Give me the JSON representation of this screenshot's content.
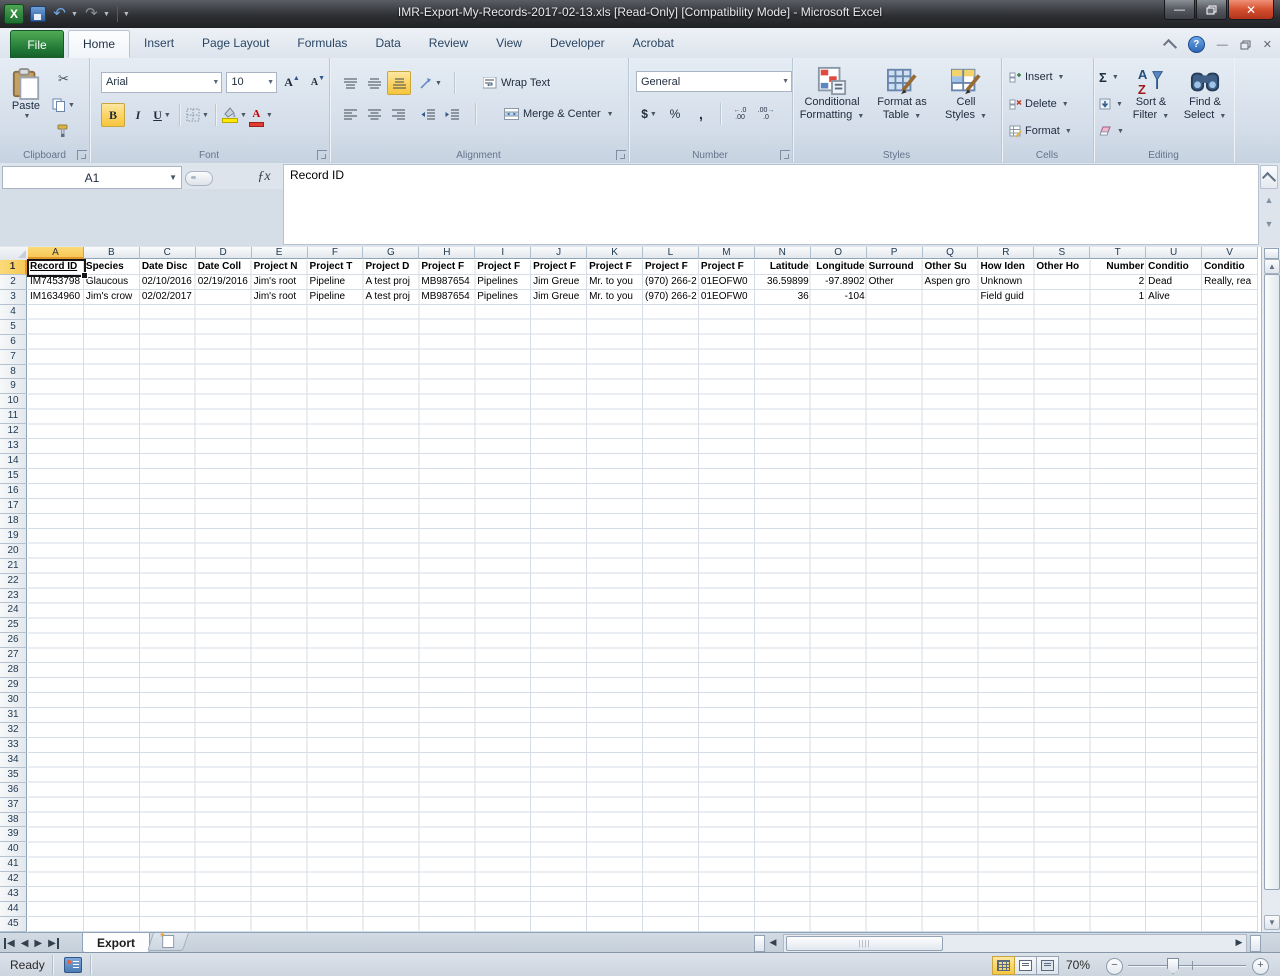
{
  "titlebar": {
    "title": "IMR-Export-My-Records-2017-02-13.xls  [Read-Only]  [Compatibility Mode]  -  Microsoft Excel"
  },
  "tabs": {
    "file": "File",
    "items": [
      "Home",
      "Insert",
      "Page Layout",
      "Formulas",
      "Data",
      "Review",
      "View",
      "Developer",
      "Acrobat"
    ],
    "active": "Home"
  },
  "ribbon": {
    "clipboard": {
      "label": "Clipboard",
      "paste": "Paste"
    },
    "font": {
      "label": "Font",
      "family": "Arial",
      "size": "10"
    },
    "alignment": {
      "label": "Alignment",
      "wrap_text": "Wrap Text",
      "merge_center": "Merge & Center"
    },
    "number": {
      "label": "Number",
      "format": "General"
    },
    "styles": {
      "label": "Styles",
      "conditional_line1": "Conditional",
      "conditional_line2": "Formatting",
      "format_table_line1": "Format as",
      "format_table_line2": "Table",
      "cell_styles_line1": "Cell",
      "cell_styles_line2": "Styles"
    },
    "cells": {
      "label": "Cells",
      "insert": "Insert",
      "delete": "Delete",
      "format": "Format"
    },
    "editing": {
      "label": "Editing",
      "sort_line1": "Sort &",
      "sort_line2": "Filter",
      "find_line1": "Find &",
      "find_line2": "Select"
    }
  },
  "formula_bar": {
    "name_box": "A1",
    "fx": "ƒx",
    "value": "Record ID"
  },
  "grid": {
    "columns": [
      "A",
      "B",
      "C",
      "D",
      "E",
      "F",
      "G",
      "H",
      "I",
      "J",
      "K",
      "L",
      "M",
      "N",
      "O",
      "P",
      "Q",
      "R",
      "S",
      "T",
      "U",
      "V"
    ],
    "visible_rows": 45,
    "selected_cell": "A1",
    "right_align_columns": [
      "N",
      "O",
      "T"
    ],
    "rows": [
      {
        "r": 1,
        "bold": true,
        "underline": [
          "A"
        ],
        "cells": {
          "A": "Record ID",
          "B": "Species",
          "C": "Date Disc",
          "D": "Date Coll",
          "E": "Project N",
          "F": "Project T",
          "G": "Project D",
          "H": "Project F",
          "I": "Project F",
          "J": "Project F",
          "K": "Project F",
          "L": "Project F",
          "M": "Project F",
          "N": "Latitude",
          "O": "Longitude",
          "P": "Surround",
          "Q": "Other Su",
          "R": "How Iden",
          "S": "Other Ho",
          "T": "Number",
          "U": "Conditio",
          "V": "Conditio"
        }
      },
      {
        "r": 2,
        "cells": {
          "A": "IM7453798",
          "B": "Glaucous",
          "C": "02/10/2016",
          "D": "02/19/2016",
          "E": "Jim's root",
          "F": "Pipeline",
          "G": "A test proj",
          "H": "MB987654",
          "I": "Pipelines",
          "J": "Jim Greue",
          "K": "Mr. to you",
          "L": "(970) 266-2",
          "M": "01EOFW0",
          "N": "36.59899",
          "O": "-97.8902",
          "P": "Other",
          "Q": "Aspen gro",
          "R": "Unknown",
          "S": "",
          "T": "2",
          "U": "Dead",
          "V": "Really, rea"
        }
      },
      {
        "r": 3,
        "cells": {
          "A": "IM1634960",
          "B": "Jim's crow",
          "C": "02/02/2017",
          "D": "",
          "E": "Jim's root",
          "F": "Pipeline",
          "G": "A test proj",
          "H": "MB987654",
          "I": "Pipelines",
          "J": "Jim Greue",
          "K": "Mr. to you",
          "L": "(970) 266-2",
          "M": "01EOFW0",
          "N": "36",
          "O": "-104",
          "P": "",
          "Q": "",
          "R": "Field guid",
          "S": "",
          "T": "1",
          "U": "Alive",
          "V": ""
        }
      }
    ]
  },
  "sheet_tabs": {
    "active": "Export"
  },
  "status_bar": {
    "mode": "Ready",
    "zoom": "70%"
  },
  "colors": {
    "selection_header": "#f6c856",
    "file_tab_green": "#1e7434",
    "close_red": "#d4502f",
    "fill_yellow": "#ffe800",
    "font_red": "#e03c31",
    "active_toggle": "#fbd466"
  }
}
